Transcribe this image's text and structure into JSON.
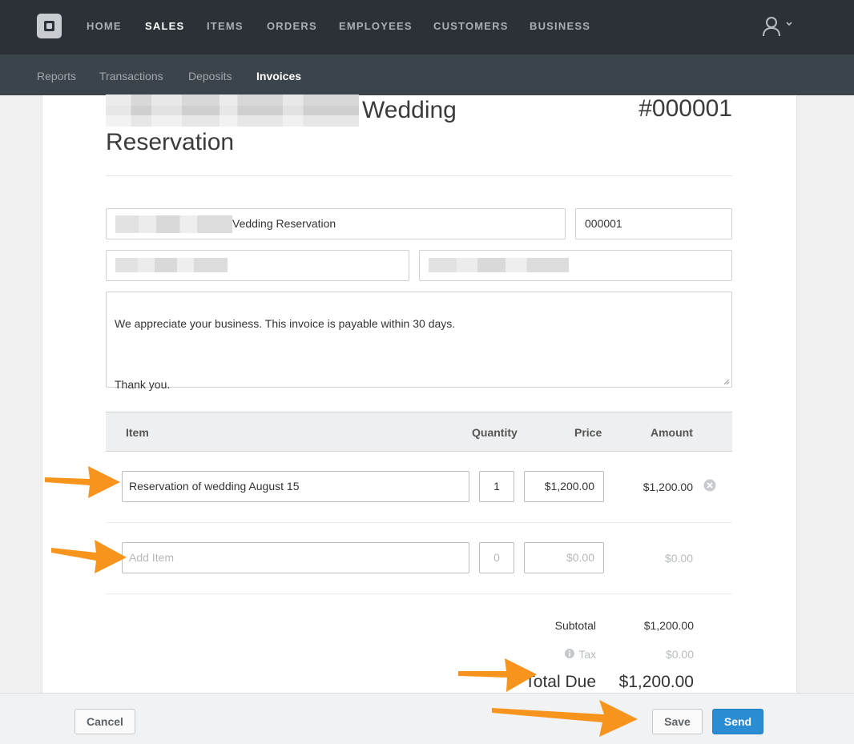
{
  "topnav": {
    "items": [
      "HOME",
      "SALES",
      "ITEMS",
      "ORDERS",
      "EMPLOYEES",
      "CUSTOMERS",
      "BUSINESS"
    ],
    "active": "SALES"
  },
  "subnav": {
    "items": [
      "Reports",
      "Transactions",
      "Deposits",
      "Invoices"
    ],
    "active": "Invoices"
  },
  "invoice": {
    "title_suffix": "Wedding Reservation",
    "number": "#000001",
    "title_field_visible": "Vedding Reservation",
    "id_field": "000001",
    "message_line1": "We appreciate your business. This invoice is payable within 30 days.",
    "message_line2": "Thank you."
  },
  "table": {
    "headers": {
      "item": "Item",
      "quantity": "Quantity",
      "price": "Price",
      "amount": "Amount"
    },
    "row1": {
      "item": "Reservation of wedding August 15",
      "quantity": "1",
      "price": "$1,200.00",
      "amount": "$1,200.00"
    },
    "new_row": {
      "item_placeholder": "Add Item",
      "quantity": "0",
      "price": "$0.00",
      "amount": "$0.00"
    }
  },
  "totals": {
    "subtotal_label": "Subtotal",
    "subtotal": "$1,200.00",
    "tax_label": "Tax",
    "tax": "$0.00",
    "total_label": "Total Due",
    "total": "$1,200.00"
  },
  "footer": {
    "cancel": "Cancel",
    "save": "Save",
    "send": "Send"
  },
  "colors": {
    "topnav": "#2b3136",
    "subnav": "#3c444b",
    "accent": "#2a8dd4",
    "arrow": "#f7941d"
  }
}
